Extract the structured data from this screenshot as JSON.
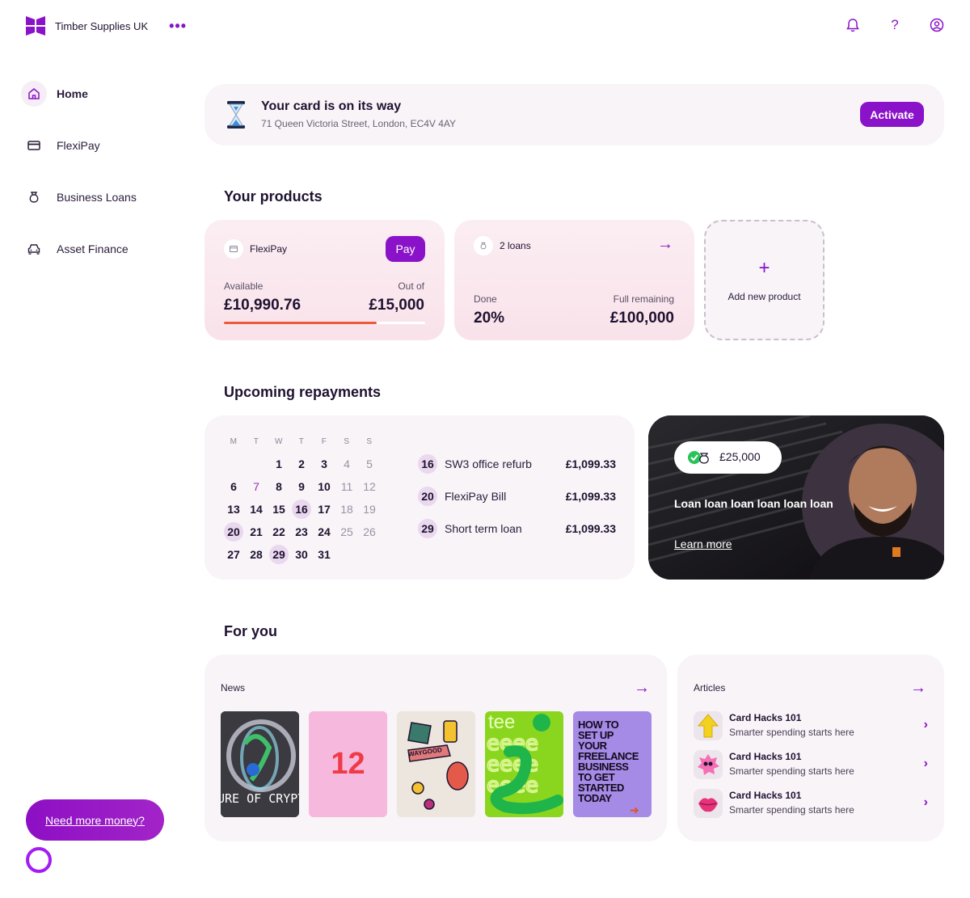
{
  "header": {
    "company": "Timber Supplies UK",
    "more_icon": "more-dots-icon",
    "icons": [
      "bell-icon",
      "help-icon",
      "user-icon"
    ]
  },
  "sidebar": {
    "items": [
      {
        "label": "Home",
        "icon": "home-icon",
        "active": true
      },
      {
        "label": "FlexiPay",
        "icon": "card-icon"
      },
      {
        "label": "Business Loans",
        "icon": "money-bag-icon"
      },
      {
        "label": "Asset Finance",
        "icon": "car-icon"
      }
    ],
    "need_money": "Need more money?"
  },
  "banner": {
    "title": "Your card is on its way",
    "address": "71 Queen Victoria Street, London, EC4V 4AY",
    "action": "Activate",
    "icon": "hourglass-icon"
  },
  "products": {
    "title": "Your products",
    "flexipay": {
      "name": "FlexiPay",
      "action": "Pay",
      "available_label": "Available",
      "available": "£10,990.76",
      "out_of_label": "Out of",
      "limit": "£15,000",
      "progress": 0.76
    },
    "loans": {
      "name": "2 loans",
      "done_label": "Done",
      "done": "20%",
      "remaining_label": "Full remaining",
      "remaining": "£100,000"
    },
    "add": "Add new product"
  },
  "repayments": {
    "title": "Upcoming repayments",
    "weekdays": [
      "M",
      "T",
      "W",
      "T",
      "F",
      "S",
      "S"
    ],
    "days": [
      [
        "",
        "",
        "1",
        "2",
        "3",
        "4",
        "5"
      ],
      [
        "6",
        "7",
        "8",
        "9",
        "10",
        "11",
        "12"
      ],
      [
        "13",
        "14",
        "15",
        "16",
        "17",
        "18",
        "19"
      ],
      [
        "20",
        "21",
        "22",
        "23",
        "24",
        "25",
        "26"
      ],
      [
        "27",
        "28",
        "29",
        "30",
        "31",
        "",
        ""
      ]
    ],
    "highlighted": [
      "16",
      "20",
      "29"
    ],
    "today": "7",
    "items": [
      {
        "day": "16",
        "name": "SW3 office refurb",
        "amount": "£1,099.33"
      },
      {
        "day": "20",
        "name": "FlexiPay Bill",
        "amount": "£1,099.33"
      },
      {
        "day": "29",
        "name": "Short term loan",
        "amount": "£1,099.33"
      }
    ]
  },
  "promo": {
    "amount": "£25,000",
    "text": "Loan loan loan loan loan loan",
    "link": "Learn more"
  },
  "for_you": {
    "title": "For you",
    "news": {
      "label": "News",
      "thumbs": [
        {
          "name": "crypto",
          "text": "URE OF CRYPT S WITH X-LE"
        },
        {
          "name": "number",
          "text": "12"
        },
        {
          "name": "stickers",
          "text": "WAYGOOD"
        },
        {
          "name": "loan-talk",
          "text": "tee"
        },
        {
          "name": "freelance",
          "text": "HOW TO SET UP YOUR FREELANCE BUSINESS TO GET STARTED TODAY"
        }
      ]
    },
    "articles": {
      "label": "Articles",
      "items": [
        {
          "title": "Card Hacks 101",
          "subtitle": "Smarter spending starts here",
          "icon": "arrow-up-3d-icon"
        },
        {
          "title": "Card Hacks 101",
          "subtitle": "Smarter spending starts here",
          "icon": "pink-blob-icon"
        },
        {
          "title": "Card Hacks 101",
          "subtitle": "Smarter spending starts here",
          "icon": "lips-icon"
        }
      ]
    }
  },
  "colors": {
    "accent": "#8a12c9",
    "progress": "#f05a3c",
    "card_pink": "#fbe8ef"
  }
}
